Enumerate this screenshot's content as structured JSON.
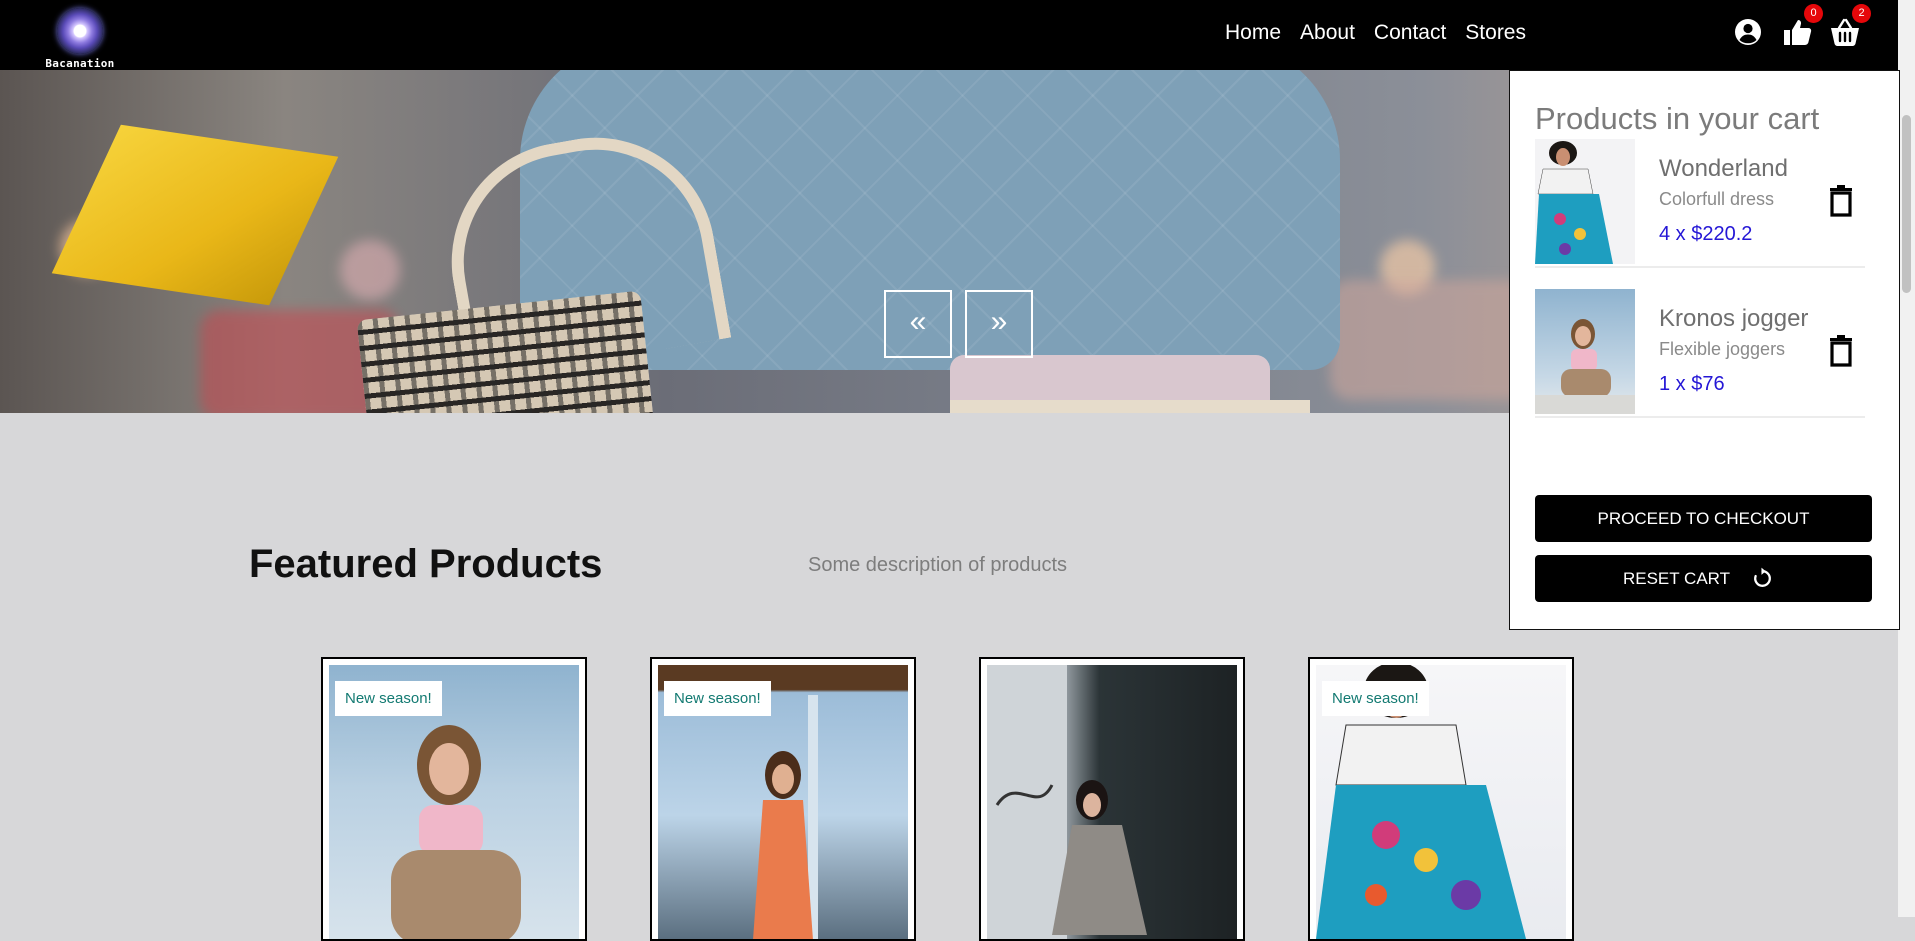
{
  "brand": {
    "name": "Bacanation"
  },
  "nav": {
    "links": [
      "Home",
      "About",
      "Contact",
      "Stores"
    ],
    "likes_count": "0",
    "cart_count": "2"
  },
  "hero": {
    "prev_label": "«",
    "next_label": "»"
  },
  "featured": {
    "title": "Featured Products",
    "description": "Some description of products",
    "cards": [
      {
        "tag": "New season!"
      },
      {
        "tag": "New season!"
      },
      {
        "tag": ""
      },
      {
        "tag": "New season!"
      }
    ]
  },
  "cart": {
    "title": "Products in your cart",
    "items": [
      {
        "name": "Wonderland",
        "subtitle": "Colorfull dress",
        "price": "4 x $220.2"
      },
      {
        "name": "Kronos jogger",
        "subtitle": "Flexible joggers",
        "price": "1 x $76"
      }
    ],
    "checkout_label": "PROCEED TO CHECKOUT",
    "reset_label": "RESET CART"
  },
  "colors": {
    "nav_bg": "#000000",
    "badge": "#e6070a",
    "price": "#2517d6",
    "tag_text": "#137a72"
  }
}
